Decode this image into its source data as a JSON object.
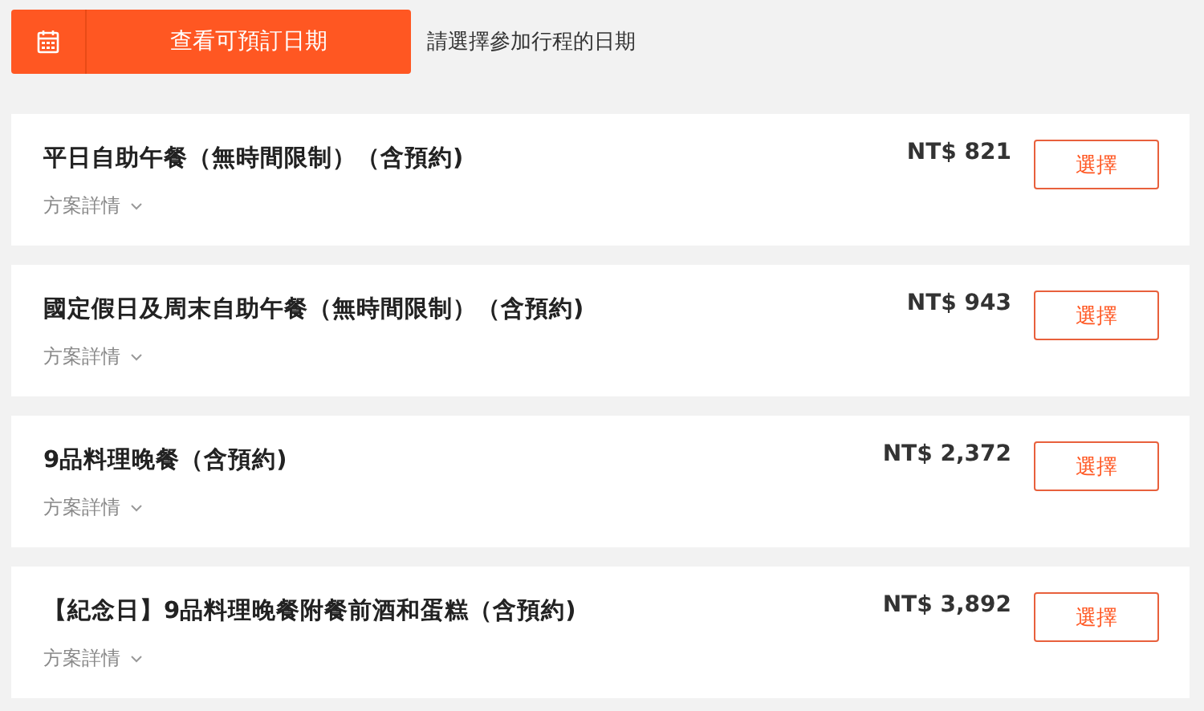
{
  "date_bar": {
    "button_label": "查看可預訂日期",
    "hint": "請選擇參加行程的日期"
  },
  "packages": [
    {
      "title": "平日自助午餐（無時間限制）（含預約)",
      "details_label": "方案詳情",
      "price": "NT$ 821",
      "select_label": "選擇"
    },
    {
      "title": "國定假日及周末自助午餐（無時間限制）（含預約)",
      "details_label": "方案詳情",
      "price": "NT$ 943",
      "select_label": "選擇"
    },
    {
      "title": "9品料理晚餐（含預約)",
      "details_label": "方案詳情",
      "price": "NT$ 2,372",
      "select_label": "選擇"
    },
    {
      "title": "【紀念日】9品料理晚餐附餐前酒和蛋糕（含預約)",
      "details_label": "方案詳情",
      "price": "NT$ 3,892",
      "select_label": "選擇"
    }
  ]
}
